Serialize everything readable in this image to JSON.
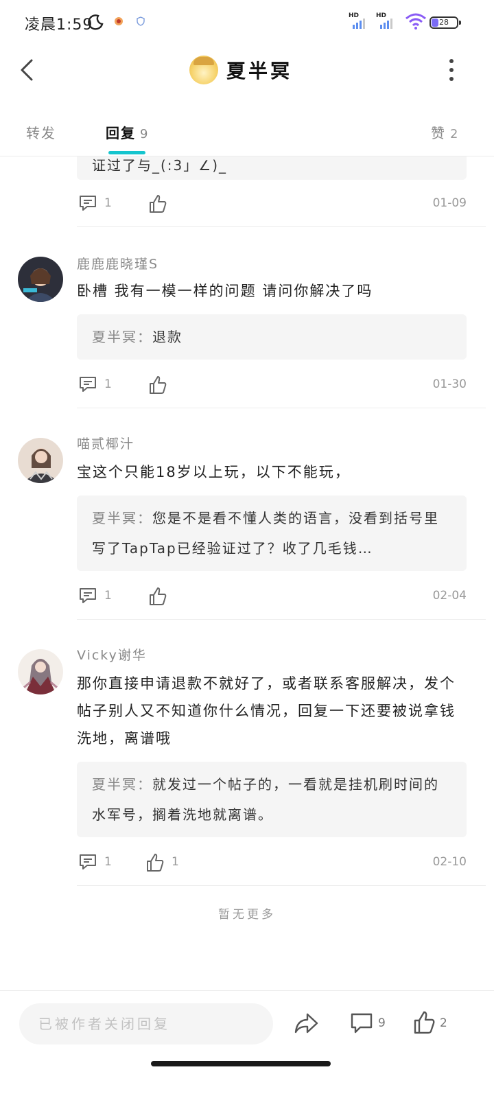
{
  "status_bar": {
    "time": "凌晨1:59",
    "signal_label_1": "HD",
    "signal_label_2": "HD",
    "battery": "28"
  },
  "header": {
    "title": "夏半冥"
  },
  "tabs": {
    "forward_label": "转发",
    "reply_label": "回复",
    "reply_count": "9",
    "like_label": "赞",
    "like_count": "2"
  },
  "comments": [
    {
      "quote_partial": "证过了与_(:3」∠)_",
      "comment_count": "1",
      "date": "01-09"
    },
    {
      "user": "鹿鹿鹿晓瑾S",
      "text": "卧槽 我有一模一样的问题 请问你解决了吗",
      "quote_name": "夏半冥：",
      "quote_text": "退款",
      "comment_count": "1",
      "date": "01-30"
    },
    {
      "user": "喵贰椰汁",
      "text": "宝这个只能18岁以上玩，以下不能玩，",
      "quote_name": "夏半冥：",
      "quote_text": "您是不是看不懂人类的语言，没看到括号里写了TapTap已经验证过了？收了几毛钱…",
      "comment_count": "1",
      "date": "02-04"
    },
    {
      "user": "Vicky谢华",
      "text": "那你直接申请退款不就好了，或者联系客服解决，发个帖子别人又不知道你什么情况，回复一下还要被说拿钱洗地，离谱哦",
      "quote_name": "夏半冥：",
      "quote_text": "就发过一个帖子的，一看就是挂机刷时间的水军号，搁着洗地就离谱。",
      "comment_count": "1",
      "like_count": "1",
      "date": "02-10"
    }
  ],
  "no_more_text": "暂无更多",
  "bottom_bar": {
    "placeholder": "已被作者关闭回复",
    "comment_count": "9",
    "like_count": "2"
  },
  "colors": {
    "accent": "#15c5ce",
    "quote_bg": "#f5f5f5",
    "muted_text": "#999999"
  }
}
